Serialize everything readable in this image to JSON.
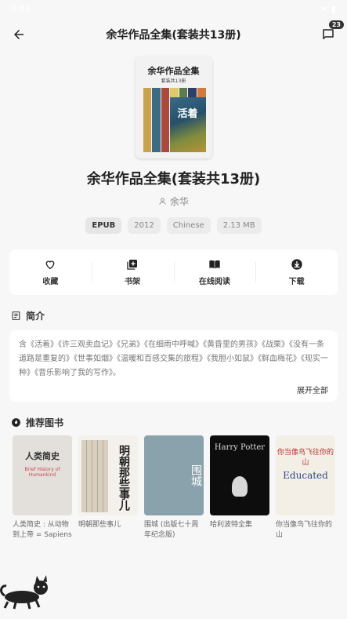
{
  "app_bar": {
    "title": "余华作品全集(套装共13册)",
    "badge_count": "23"
  },
  "book": {
    "cover_title": "余华作品全集",
    "cover_subtitle": "套装共13册",
    "cover_painting_text": "活着",
    "title": "余华作品全集(套装共13册)",
    "author": "余华",
    "tags": [
      "EPUB",
      "2012",
      "Chinese",
      "2.13 MB"
    ]
  },
  "actions": [
    {
      "label": "收藏",
      "icon": "heart-icon"
    },
    {
      "label": "书架",
      "icon": "add-to-shelf-icon"
    },
    {
      "label": "在线阅读",
      "icon": "book-open-icon"
    },
    {
      "label": "下载",
      "icon": "download-icon"
    }
  ],
  "intro": {
    "heading": "简介",
    "text": "含《活着》《许三观卖血记》《兄弟》《在细雨中呼喊》《黄昏里的男孩》《战栗》《没有一条道路是重复的》《世事如烟》《温暖和百感交集的旅程》《我胆小如鼠》《鲜血梅花》《现实一种》《音乐影响了我的写作》。",
    "expand_label": "展开全部"
  },
  "recommend": {
    "heading": "推荐图书",
    "books": [
      {
        "title": "人类简史 : 从动物到上帝 = Sapiens",
        "cover_text": "人类简史",
        "cover_sub": "Brief History of Humankind"
      },
      {
        "title": "明朝那些事儿",
        "cover_text": "明朝那些事儿"
      },
      {
        "title": "围城 (出版七十周年纪念版)",
        "cover_text": "围城"
      },
      {
        "title": "哈利波特全集",
        "cover_text": "Harry Potter"
      },
      {
        "title": "你当像鸟飞往你的山",
        "cover_text": "你当像鸟飞往你的山",
        "cover_sub": "Educated"
      }
    ]
  },
  "colors": {
    "background": "#f7f7f7",
    "card": "#ffffff",
    "text": "#222222",
    "muted": "#888888"
  }
}
